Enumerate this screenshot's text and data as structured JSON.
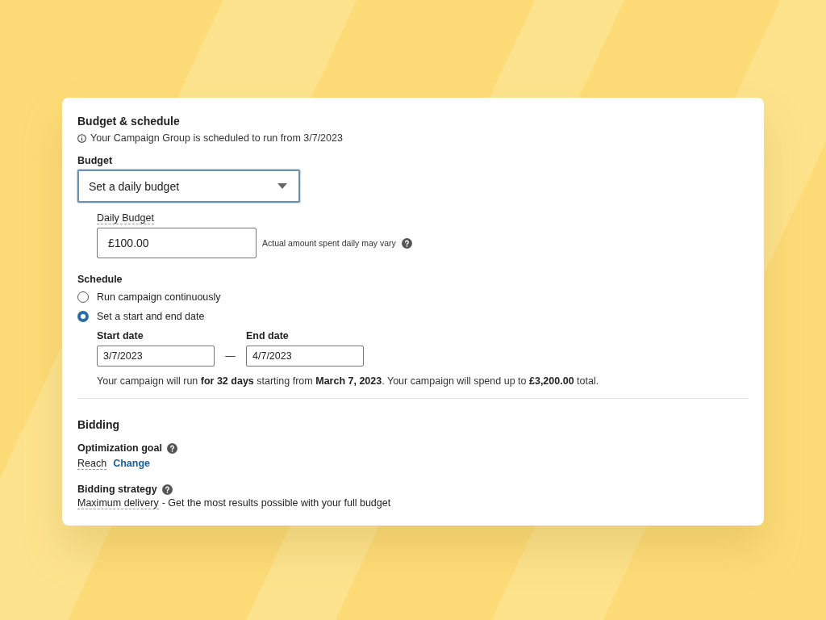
{
  "budget_schedule": {
    "title": "Budget & schedule",
    "info": "Your Campaign Group is scheduled to run from 3/7/2023",
    "budget": {
      "label": "Budget",
      "dropdown_value": "Set a daily budget",
      "daily_label": "Daily Budget",
      "daily_value": "£100.00",
      "hint": "Actual amount spent daily may vary"
    },
    "schedule": {
      "label": "Schedule",
      "options": [
        {
          "label": "Run campaign continuously",
          "selected": false
        },
        {
          "label": "Set a start and end date",
          "selected": true
        }
      ],
      "start_label": "Start date",
      "start_value": "3/7/2023",
      "separator": "—",
      "end_label": "End date",
      "end_value": "4/7/2023",
      "summary": "Your campaign will run **for 32 days** starting from **March 7, 2023**. Your campaign will spend up to **£3,200.00** total."
    }
  },
  "bidding": {
    "title": "Bidding",
    "goal_label": "Optimization goal",
    "goal_value": "Reach",
    "change_link": "Change",
    "strategy_label": "Bidding strategy",
    "strategy_value": "Maximum delivery",
    "strategy_description": "- Get the most results possible with your full budget"
  }
}
